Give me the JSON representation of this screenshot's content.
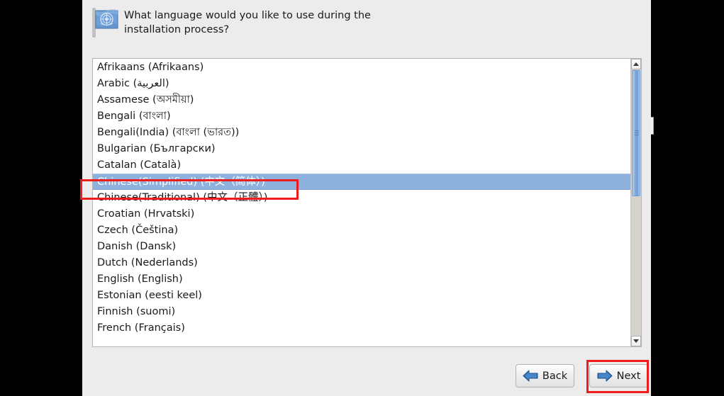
{
  "window": {
    "background_color": "#ececec",
    "outside_color": "#000000"
  },
  "header": {
    "icon": "flag-icon",
    "prompt_line1": "What language would you like to use during the",
    "prompt_line2": "installation process?",
    "prompt_full": "What language would you like to use during the installation process?"
  },
  "language_list": {
    "selected_index": 7,
    "selected_value": "Chinese(Simplified) (中文（简体）)",
    "items": [
      {
        "label": "Afrikaans (Afrikaans)"
      },
      {
        "label": "Arabic (العربية)"
      },
      {
        "label": "Assamese (অসমীয়া)"
      },
      {
        "label": "Bengali (বাংলা)"
      },
      {
        "label": "Bengali(India) (বাংলা (ভারত))"
      },
      {
        "label": "Bulgarian (Български)"
      },
      {
        "label": "Catalan (Català)"
      },
      {
        "label": "Chinese(Simplified) (中文（简体）)"
      },
      {
        "label": "Chinese(Traditional) (中文（正體）)"
      },
      {
        "label": "Croatian (Hrvatski)"
      },
      {
        "label": "Czech (Čeština)"
      },
      {
        "label": "Danish (Dansk)"
      },
      {
        "label": "Dutch (Nederlands)"
      },
      {
        "label": "English (English)"
      },
      {
        "label": "Estonian (eesti keel)"
      },
      {
        "label": "Finnish (suomi)"
      },
      {
        "label": "French (Français)"
      }
    ]
  },
  "scrollbar": {
    "up_arrow": "chevron-up-icon",
    "down_arrow": "chevron-down-icon",
    "thumb_position_percent": 4,
    "thumb_size_percent": 44
  },
  "buttons": {
    "back_label": "Back",
    "back_icon": "arrow-left-icon",
    "next_label": "Next",
    "next_icon": "arrow-right-icon"
  },
  "annotations": {
    "highlight_color": "#ee1c1c",
    "boxes": [
      {
        "target": "Chinese(Simplified) (中文（简体）)"
      },
      {
        "target": "Next"
      }
    ]
  },
  "colors": {
    "selection_blue": "#8eb2dd",
    "dialog_gray": "#ececec",
    "list_white": "#ffffff",
    "scroll_thumb_blue": "#7aa6da"
  }
}
